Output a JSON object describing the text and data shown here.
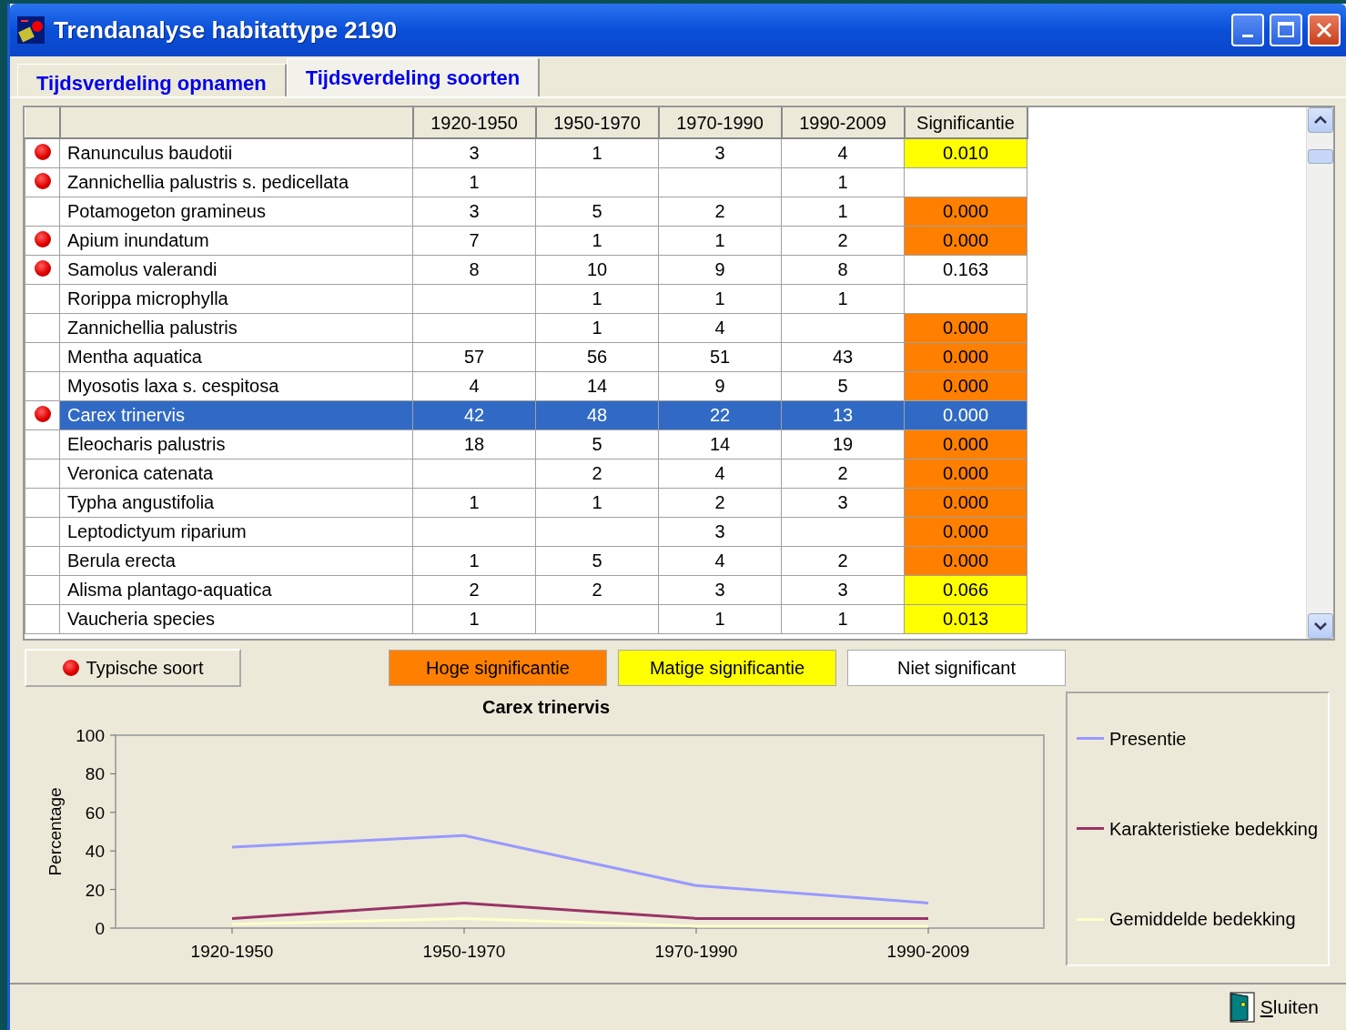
{
  "window": {
    "title": "Trendanalyse habitattype 2190"
  },
  "tabs": [
    {
      "label": "Tijdsverdeling opnamen",
      "selected": false
    },
    {
      "label": "Tijdsverdeling soorten",
      "selected": true
    }
  ],
  "table": {
    "columns": [
      "1920-1950",
      "1950-1970",
      "1970-1990",
      "1990-2009",
      "Significantie"
    ],
    "rows": [
      {
        "typical": true,
        "name": "Ranunculus baudotii",
        "period_1": "3",
        "period_2": "1",
        "period_3": "3",
        "period_4": "4",
        "significance": {
          "value": "0.010",
          "kind": "moderate"
        },
        "selected": false
      },
      {
        "typical": true,
        "name": "Zannichellia palustris s. pedicellata",
        "period_1": "1",
        "period_4": "1",
        "significance": {
          "kind": "none"
        },
        "selected": false
      },
      {
        "typical": false,
        "name": "Potamogeton gramineus",
        "period_1": "3",
        "period_2": "5",
        "period_3": "2",
        "period_4": "1",
        "significance": {
          "value": "0.000",
          "kind": "high"
        },
        "selected": false
      },
      {
        "typical": true,
        "name": "Apium inundatum",
        "period_1": "7",
        "period_2": "1",
        "period_3": "1",
        "period_4": "2",
        "significance": {
          "value": "0.000",
          "kind": "high"
        },
        "selected": false
      },
      {
        "typical": true,
        "name": "Samolus valerandi",
        "period_1": "8",
        "period_2": "10",
        "period_3": "9",
        "period_4": "8",
        "significance": {
          "value": "0.163",
          "kind": "none"
        },
        "selected": false
      },
      {
        "typical": false,
        "name": "Rorippa microphylla",
        "period_2": "1",
        "period_3": "1",
        "period_4": "1",
        "significance": {
          "kind": "none"
        },
        "selected": false
      },
      {
        "typical": false,
        "name": "Zannichellia palustris",
        "period_2": "1",
        "period_3": "4",
        "significance": {
          "value": "0.000",
          "kind": "high"
        },
        "selected": false
      },
      {
        "typical": false,
        "name": "Mentha aquatica",
        "period_1": "57",
        "period_2": "56",
        "period_3": "51",
        "period_4": "43",
        "significance": {
          "value": "0.000",
          "kind": "high"
        },
        "selected": false
      },
      {
        "typical": false,
        "name": "Myosotis laxa s. cespitosa",
        "period_1": "4",
        "period_2": "14",
        "period_3": "9",
        "period_4": "5",
        "significance": {
          "value": "0.000",
          "kind": "high"
        },
        "selected": false
      },
      {
        "typical": true,
        "name": "Carex trinervis",
        "period_1": "42",
        "period_2": "48",
        "period_3": "22",
        "period_4": "13",
        "significance": {
          "value": "0.000",
          "kind": "high"
        },
        "selected": true
      },
      {
        "typical": false,
        "name": "Eleocharis palustris",
        "period_1": "18",
        "period_2": "5",
        "period_3": "14",
        "period_4": "19",
        "significance": {
          "value": "0.000",
          "kind": "high"
        },
        "selected": false
      },
      {
        "typical": false,
        "name": "Veronica catenata",
        "period_2": "2",
        "period_3": "4",
        "period_4": "2",
        "significance": {
          "value": "0.000",
          "kind": "high"
        },
        "selected": false
      },
      {
        "typical": false,
        "name": "Typha angustifolia",
        "period_1": "1",
        "period_2": "1",
        "period_3": "2",
        "period_4": "3",
        "significance": {
          "value": "0.000",
          "kind": "high"
        },
        "selected": false
      },
      {
        "typical": false,
        "name": "Leptodictyum riparium",
        "period_3": "3",
        "significance": {
          "value": "0.000",
          "kind": "high"
        },
        "selected": false
      },
      {
        "typical": false,
        "name": "Berula erecta",
        "period_1": "1",
        "period_2": "5",
        "period_3": "4",
        "period_4": "2",
        "significance": {
          "value": "0.000",
          "kind": "high"
        },
        "selected": false
      },
      {
        "typical": false,
        "name": "Alisma plantago-aquatica",
        "period_1": "2",
        "period_2": "2",
        "period_3": "3",
        "period_4": "3",
        "significance": {
          "value": "0.066",
          "kind": "moderate"
        },
        "selected": false
      },
      {
        "typical": false,
        "name": "Vaucheria species",
        "period_1": "1",
        "period_3": "1",
        "period_4": "1",
        "significance": {
          "value": "0.013",
          "kind": "moderate"
        },
        "selected": false
      }
    ]
  },
  "legend": {
    "typical": "Typische soort",
    "significance": [
      {
        "label": "Hoge significantie",
        "kind": "high"
      },
      {
        "label": "Matige significantie",
        "kind": "moderate"
      },
      {
        "label": "Niet significant",
        "kind": "none"
      }
    ]
  },
  "chart": {
    "chart_data": {
      "type": "line",
      "title": "Carex trinervis",
      "ylabel": "Percentage",
      "categories": [
        "1920-1950",
        "1950-1970",
        "1970-1990",
        "1990-2009"
      ],
      "ylim": [
        0,
        100
      ],
      "yticks": [
        0,
        20,
        40,
        60,
        80,
        100
      ],
      "series": [
        {
          "name": "Presentie",
          "color": "#9999ff",
          "values": [
            42,
            48,
            22,
            13
          ]
        },
        {
          "name": "Karakteristieke bedekking",
          "color": "#993366",
          "values": [
            5,
            13,
            5,
            5
          ]
        },
        {
          "name": "Gemiddelde bedekking",
          "color": "#ffffcc",
          "values": [
            2,
            5,
            1,
            1
          ]
        }
      ]
    }
  },
  "close_button": {
    "label": "Sluiten"
  }
}
